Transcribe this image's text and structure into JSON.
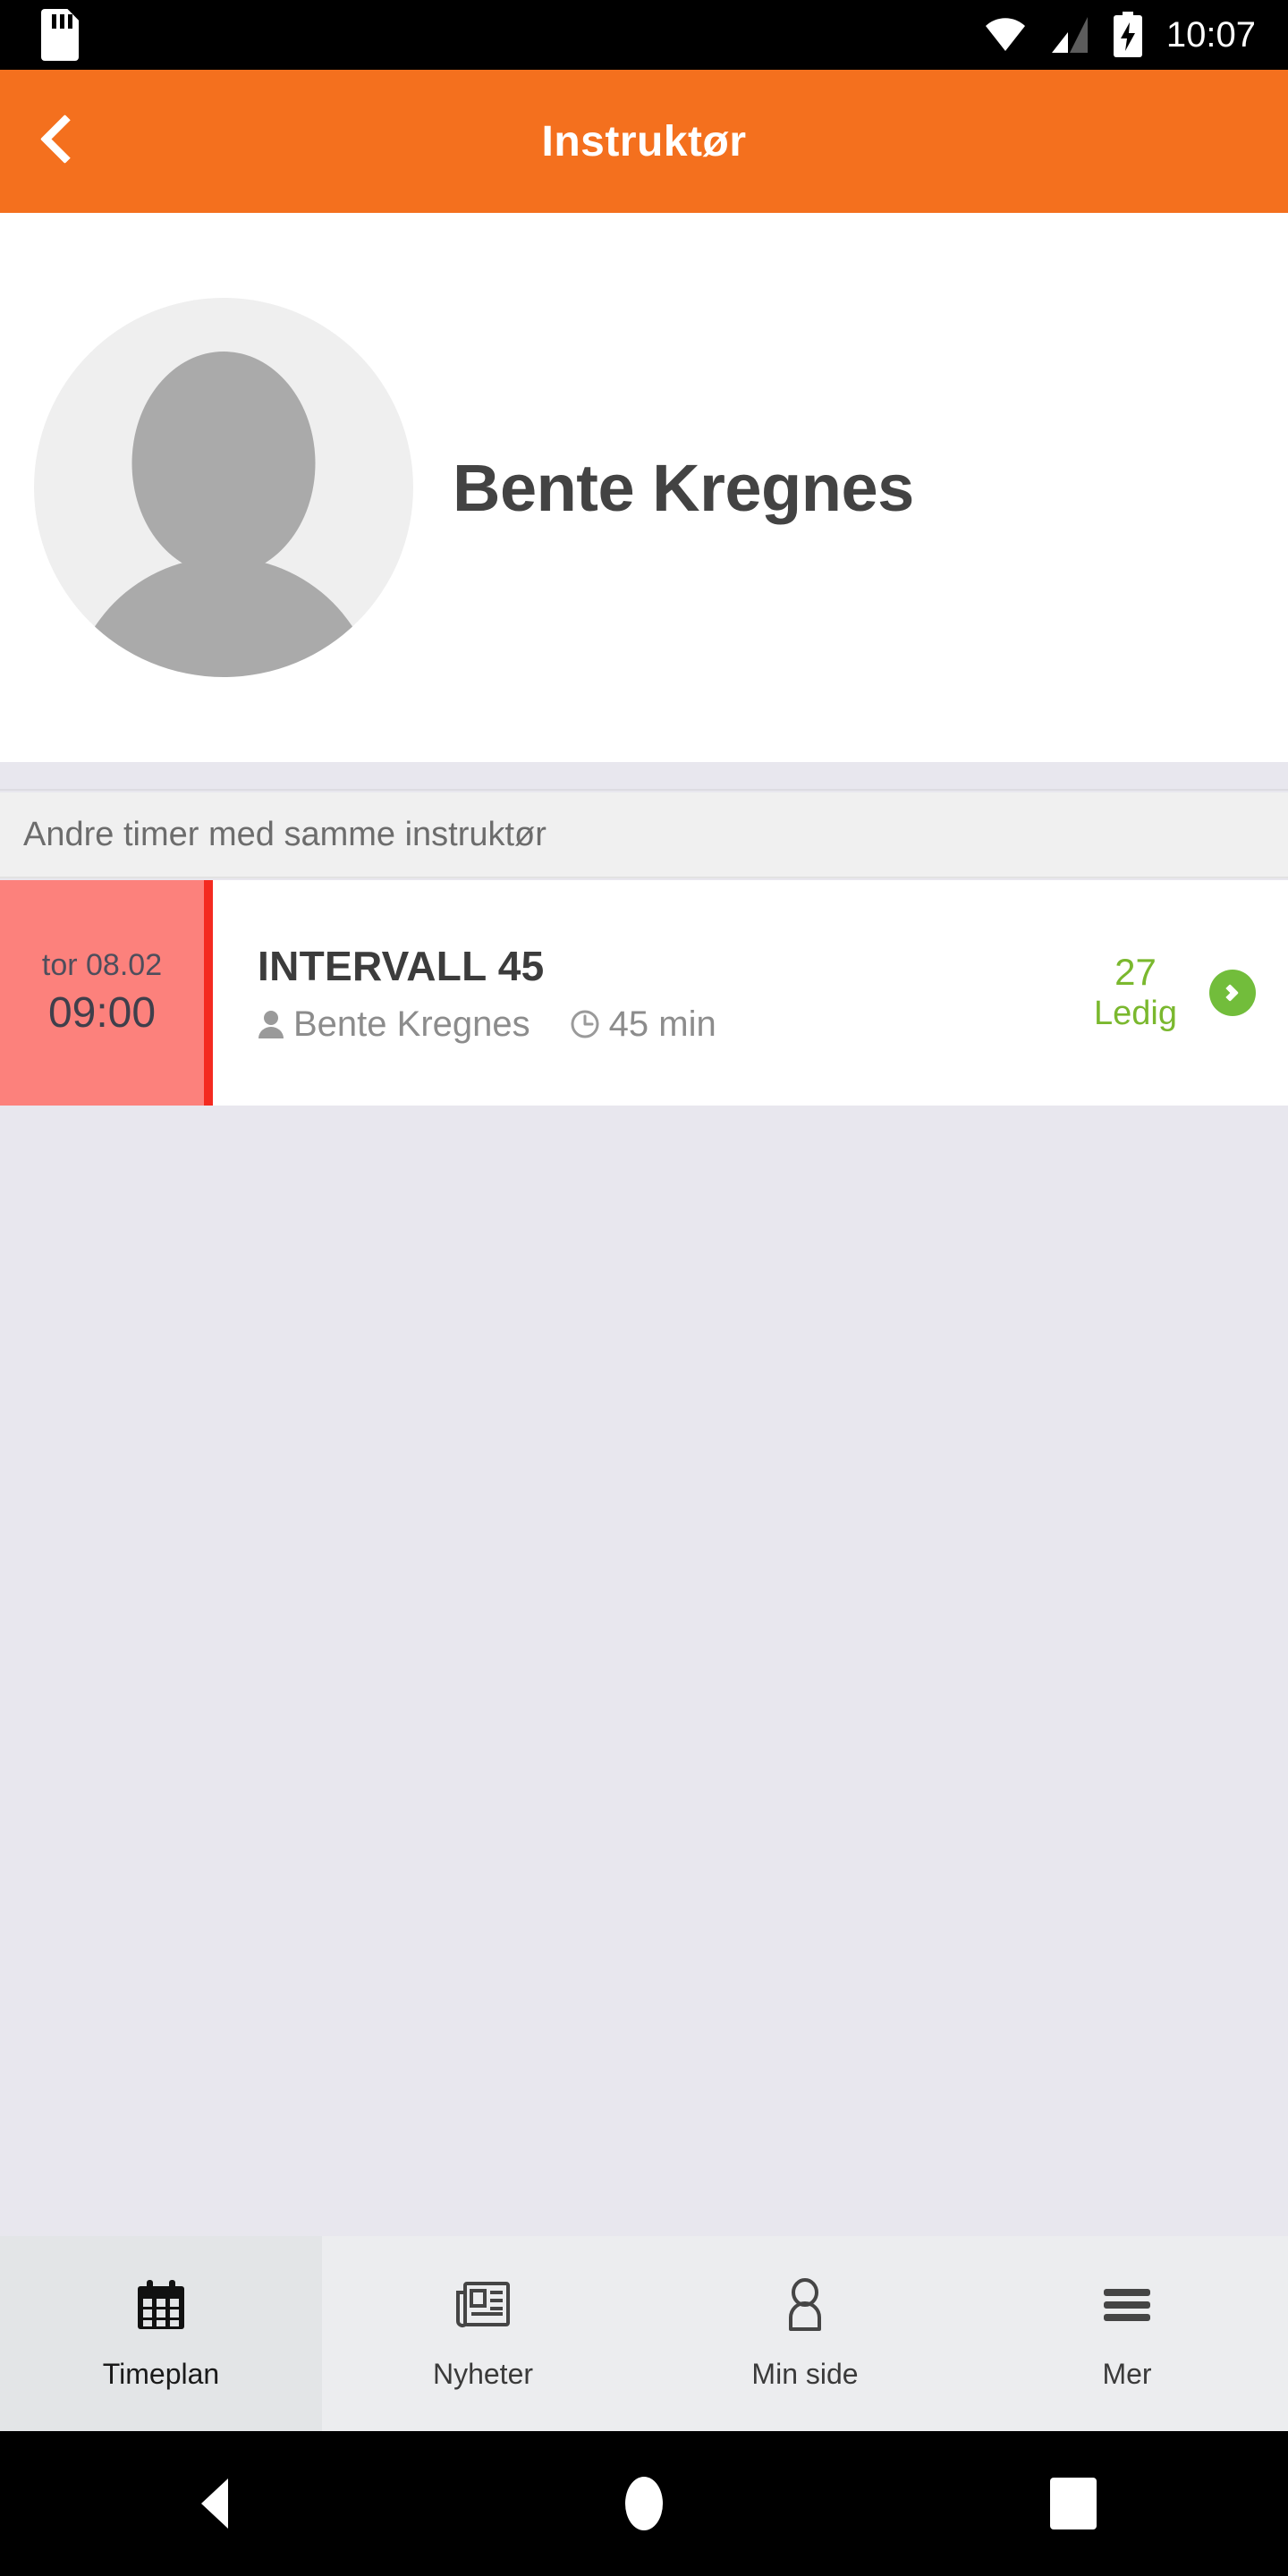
{
  "status_bar": {
    "sd_card_icon": "sd-card-icon",
    "wifi_icon": "wifi-icon",
    "signal_icon": "cellular-signal-icon",
    "battery_icon": "battery-charging-icon",
    "time": "10:07"
  },
  "app_bar": {
    "back_icon": "chevron-left-icon",
    "title": "Instruktør",
    "background_color": "#F4701E"
  },
  "profile": {
    "avatar_icon": "person-avatar-placeholder-icon",
    "name": "Bente Kregnes"
  },
  "section": {
    "header": "Andre timer med samme instruktør"
  },
  "classes": [
    {
      "date": "tor 08.02",
      "time": "09:00",
      "title": "INTERVALL 45",
      "instructor_icon": "person-icon",
      "instructor": "Bente Kregnes",
      "duration_icon": "clock-icon",
      "duration": "45 min",
      "available_count": "27",
      "available_label": "Ledig",
      "available_color": "#7AB82E",
      "go_icon": "chevron-right-circle-icon",
      "accent_bar_color": "#F42A20",
      "date_block_color": "#FC817C"
    }
  ],
  "bottom_nav": {
    "items": [
      {
        "label": "Timeplan",
        "icon": "calendar-icon",
        "active": true
      },
      {
        "label": "Nyheter",
        "icon": "newspaper-icon",
        "active": false
      },
      {
        "label": "Min side",
        "icon": "person-outline-icon",
        "active": false
      },
      {
        "label": "Mer",
        "icon": "hamburger-menu-icon",
        "active": false
      }
    ]
  },
  "android_nav": {
    "back_icon": "android-back-icon",
    "home_icon": "android-home-icon",
    "recents_icon": "android-recents-icon"
  }
}
